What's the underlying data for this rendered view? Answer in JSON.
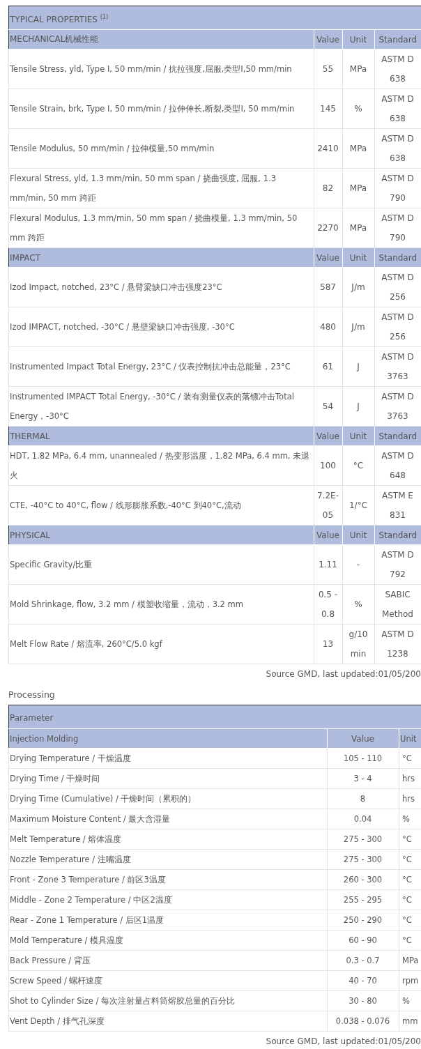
{
  "properties_table": {
    "title": "TYPICAL PROPERTIES $^{(1)}$",
    "sections": [
      {
        "name": "MECHANICAL机械性能",
        "columns": [
          "Value",
          "Unit",
          "Standard"
        ],
        "rows": [
          {
            "property": "Tensile Stress, yld, Type I, 50 mm/min / 抗拉强度,屈服,类型I,50 mm/min",
            "value": "55",
            "unit": "MPa",
            "standard": "ASTM D 638"
          },
          {
            "property": "Tensile Strain, brk, Type I, 50 mm/min / 拉伸伸长,断裂,类型I, 50 mm/min",
            "value": "145",
            "unit": "%",
            "standard": "ASTM D 638"
          },
          {
            "property": "Tensile Modulus, 50 mm/min / 拉伸模量,50 mm/min",
            "value": "2410",
            "unit": "MPa",
            "standard": "ASTM D 638"
          },
          {
            "property": "Flexural Stress, yld, 1.3 mm/min, 50 mm span / 挠曲强度, 屈服, 1.3 mm/min, 50 mm 跨距",
            "value": "82",
            "unit": "MPa",
            "standard": "ASTM D 790"
          },
          {
            "property": "Flexural Modulus, 1.3 mm/min, 50 mm span / 挠曲模量, 1.3 mm/min, 50 mm 跨距",
            "value": "2270",
            "unit": "MPa",
            "standard": "ASTM D 790"
          }
        ]
      },
      {
        "name": "IMPACT",
        "columns": [
          "Value",
          "Unit",
          "Standard"
        ],
        "rows": [
          {
            "property": "Izod Impact, notched, 23°C / 悬臂梁缺口冲击强度23°C",
            "value": "587",
            "unit": "J/m",
            "standard": "ASTM D 256"
          },
          {
            "property": "Izod IMPACT, notched, -30°C / 悬壁梁缺口冲击强度, -30°C",
            "value": "480",
            "unit": "J/m",
            "standard": "ASTM D 256"
          },
          {
            "property": "Instrumented Impact Total Energy, 23°C / 仪表控制抗冲击总能量，23°C",
            "value": "61",
            "unit": "J",
            "standard": "ASTM D 3763"
          },
          {
            "property": "Instrumented IMPACT Total Energy, -30°C / 装有测量仪表的落镖冲击Total Energy，-30°C",
            "value": "54",
            "unit": "J",
            "standard": "ASTM D 3763"
          }
        ]
      },
      {
        "name": "THERMAL",
        "columns": [
          "Value",
          "Unit",
          "Standard"
        ],
        "rows": [
          {
            "property": "HDT, 1.82 MPa, 6.4 mm, unannealed / 热变形温度，1.82 MPa, 6.4 mm, 未退火",
            "value": "100",
            "unit": "°C",
            "standard": "ASTM D 648"
          },
          {
            "property": "CTE, -40°C to 40°C, flow / 线形膨胀系数,-40°C 到40°C,流动",
            "value": "7.2E-05",
            "unit": "1/°C",
            "standard": "ASTM E 831"
          }
        ]
      },
      {
        "name": "PHYSICAL",
        "columns": [
          "Value",
          "Unit",
          "Standard"
        ],
        "rows": [
          {
            "property": "Specific Gravity/比重",
            "value": "1.11",
            "unit": "-",
            "standard": "ASTM D 792"
          },
          {
            "property": "Mold Shrinkage, flow, 3.2 mm / 模塑收缩量，流动，3.2 mm",
            "value": "0.5 - 0.8",
            "unit": "%",
            "standard": "SABIC Method"
          },
          {
            "property": "Melt Flow Rate / 熔流率, 260°C/5.0 kgf",
            "value": "13",
            "unit": "g/10 min",
            "standard": "ASTM D 1238"
          }
        ]
      }
    ]
  },
  "source_note_1": "Source GMD, last updated:01/05/200",
  "processing": {
    "heading": "Processing",
    "table": {
      "title": "Parameter",
      "section": "Injection Molding",
      "columns": [
        "Value",
        "Unit"
      ],
      "rows": [
        {
          "parameter": "Drying Temperature / 干燥温度",
          "value": "105 - 110",
          "unit": "°C"
        },
        {
          "parameter": "Drying Time / 干燥时间",
          "value": "3 - 4",
          "unit": "hrs"
        },
        {
          "parameter": "Drying Time (Cumulative) / 干燥时间（累积的）",
          "value": "8",
          "unit": "hrs"
        },
        {
          "parameter": "Maximum Moisture Content / 最大含湿量",
          "value": "0.04",
          "unit": "%"
        },
        {
          "parameter": "Melt Temperature / 熔体温度",
          "value": "275 - 300",
          "unit": "°C"
        },
        {
          "parameter": "Nozzle Temperature / 注嘴温度",
          "value": "275 - 300",
          "unit": "°C"
        },
        {
          "parameter": "Front - Zone 3 Temperature / 前区3温度",
          "value": "260 - 300",
          "unit": "°C"
        },
        {
          "parameter": "Middle - Zone 2 Temperature / 中区2温度",
          "value": "255 - 295",
          "unit": "°C"
        },
        {
          "parameter": "Rear - Zone 1 Temperature / 后区1温度",
          "value": "250 - 290",
          "unit": "°C"
        },
        {
          "parameter": "Mold Temperature / 模具温度",
          "value": "60 - 90",
          "unit": "°C"
        },
        {
          "parameter": "Back Pressure / 背压",
          "value": "0.3 - 0.7",
          "unit": "MPa"
        },
        {
          "parameter": "Screw Speed / 螺杆速度",
          "value": "40 - 70",
          "unit": "rpm"
        },
        {
          "parameter": "Shot to Cylinder Size / 每次注射量占料筒熔胶总量的百分比",
          "value": "30 - 80",
          "unit": "%"
        },
        {
          "parameter": "Vent Depth / 排气孔深度",
          "value": "0.038 - 0.076",
          "unit": "mm"
        }
      ]
    }
  },
  "source_note_2": "Source GMD, last updated:01/05/200"
}
